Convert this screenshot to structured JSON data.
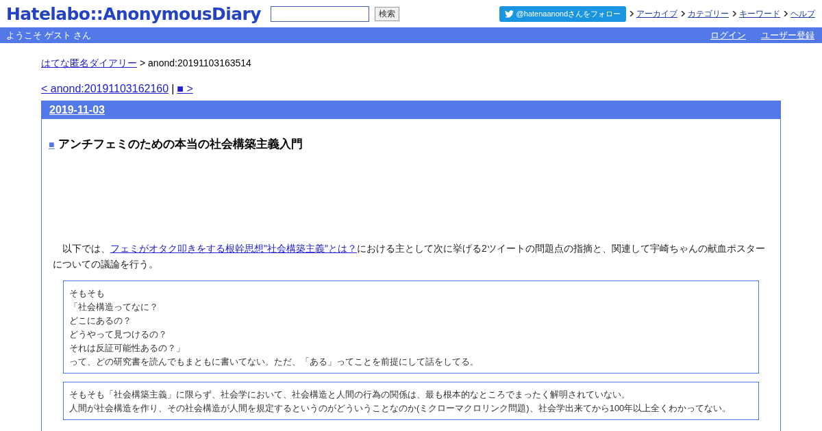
{
  "header": {
    "logo": "Hatelabo::AnonymousDiary",
    "search_button": "検索",
    "follow_button": "@hatenaanondさんをフォロー",
    "nav_links": [
      "アーカイブ",
      "カテゴリー",
      "キーワード",
      "ヘルプ"
    ]
  },
  "user_bar": {
    "welcome": "ようこそ ゲスト さん",
    "links": [
      "ログイン",
      "ユーザー登録"
    ]
  },
  "breadcrumb": {
    "link": "はてな匿名ダイアリー",
    "current": "> anond:20191103163514"
  },
  "pager": {
    "prev": "< anond:20191103162160",
    "separator": "|",
    "next": "■ >"
  },
  "day": {
    "date": "2019-11-03",
    "entry": {
      "marker": "■",
      "title": "アンチフェミのための本当の社会構築主義入門",
      "intro": {
        "before": "以下では、",
        "link": "フェミがオタク叩きをする根幹思想\"社会構築主義\"とは？",
        "after": "における主として次に挙げる2ツイートの問題点の指摘と、関連して宇崎ちゃんの献血ポスターについての議論を行う。"
      },
      "quotes": [
        {
          "lines": [
            "そもそも",
            "「社会構造ってなに？",
            "どこにあるの？",
            "どうやって見つけるの？",
            "それは反証可能性あるの？」",
            "って、どの研究書を読んでもまともに書いてない。ただ、「ある」ってことを前提にして話をしてる。"
          ]
        },
        {
          "lines": [
            "そもそも「社会構築主義」に限らず、社会学において、社会構造と人間の行為の関係は、最も根本的なところでまったく解明されていない。",
            "人間が社会構造を作り、その社会構造が人間を規定するというのがどういうことなのか(ミクローマクロリンク問題)、社会学出来てから100年以上全くわかってない。"
          ]
        }
      ]
    }
  }
}
